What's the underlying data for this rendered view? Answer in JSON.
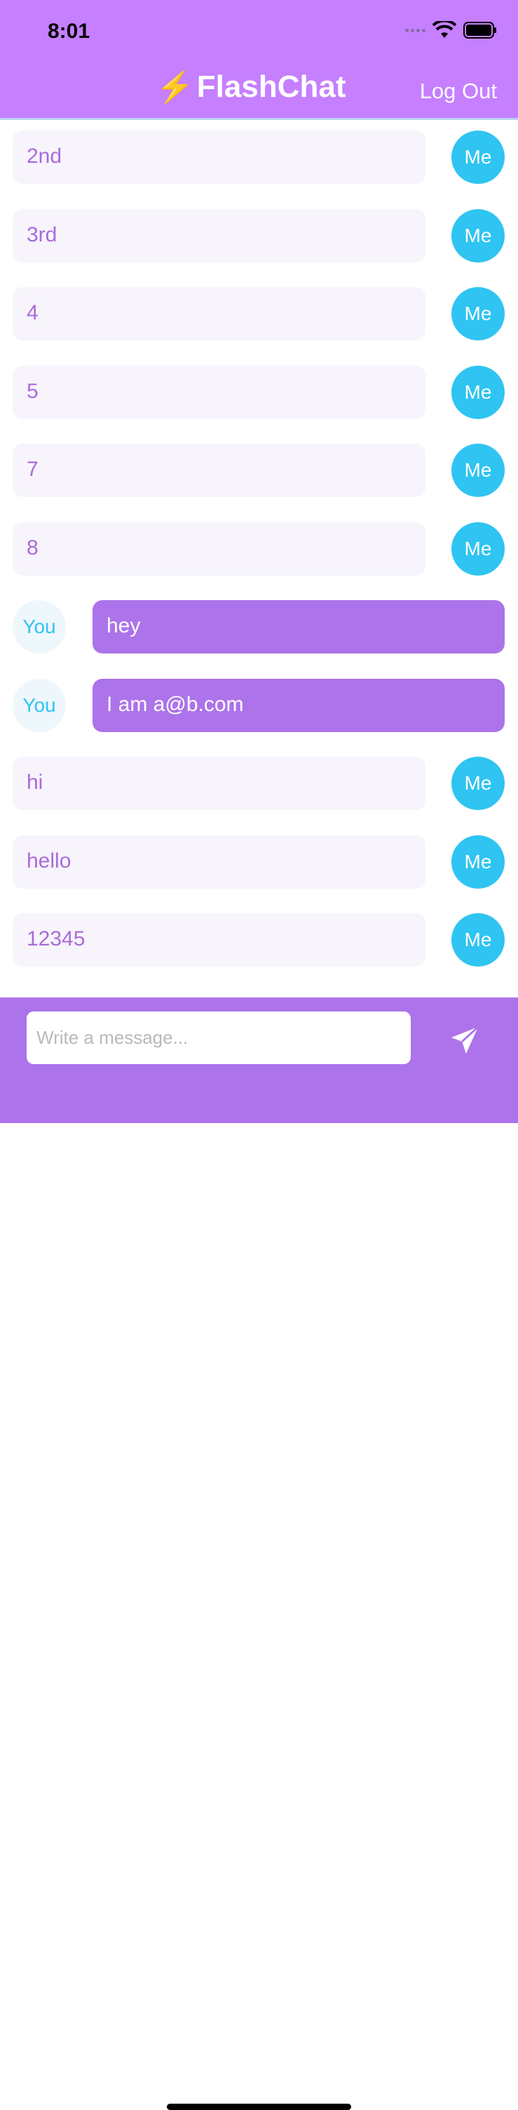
{
  "status_bar": {
    "time": "8:01"
  },
  "header": {
    "bolt": "⚡",
    "title": "FlashChat",
    "logout_label": "Log Out"
  },
  "messages": [
    {
      "sender": "me",
      "text": "2nd",
      "avatar": "Me"
    },
    {
      "sender": "me",
      "text": "3rd",
      "avatar": "Me"
    },
    {
      "sender": "me",
      "text": "4",
      "avatar": "Me"
    },
    {
      "sender": "me",
      "text": "5",
      "avatar": "Me"
    },
    {
      "sender": "me",
      "text": "7",
      "avatar": "Me"
    },
    {
      "sender": "me",
      "text": "8",
      "avatar": "Me"
    },
    {
      "sender": "you",
      "text": "hey",
      "avatar": "You"
    },
    {
      "sender": "you",
      "text": "I am a@b.com",
      "avatar": "You"
    },
    {
      "sender": "me",
      "text": "hi",
      "avatar": "Me"
    },
    {
      "sender": "me",
      "text": "hello",
      "avatar": "Me"
    },
    {
      "sender": "me",
      "text": "12345",
      "avatar": "Me"
    }
  ],
  "composer": {
    "placeholder": "Write a message...",
    "value": ""
  },
  "icons": {
    "send": "paper-plane-icon",
    "wifi": "wifi-icon",
    "battery": "battery-icon",
    "signal": "cellular-signal-icon"
  },
  "colors": {
    "header": "#c57fff",
    "accent": "#ad73ea",
    "me_avatar": "#2fc4f2",
    "me_text": "#a96bdc"
  }
}
